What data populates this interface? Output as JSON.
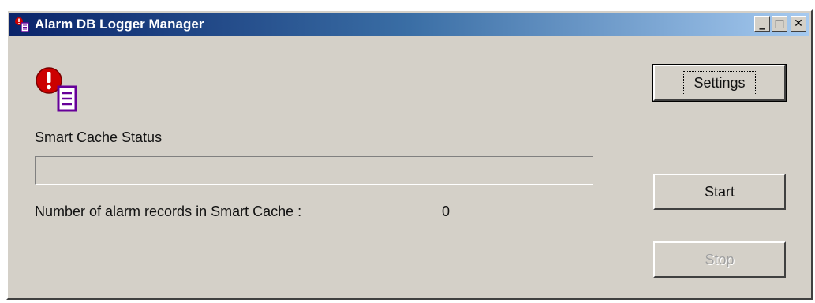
{
  "window": {
    "title": "Alarm DB Logger Manager",
    "title_icon": "alarm-db-icon",
    "controls": {
      "minimize": "_",
      "maximize": "□",
      "close": "✕"
    }
  },
  "main": {
    "app_icon": "alarm-database-icon",
    "smart_cache_label": "Smart Cache Status",
    "progress_fraction": 0,
    "records_label": "Number of alarm records in Smart Cache :",
    "records_count": "0"
  },
  "buttons": {
    "settings_label": "Settings",
    "start_label": "Start",
    "stop_label": "Stop"
  },
  "colors": {
    "face": "#d4d0c8",
    "title_start": "#0a246a",
    "title_end": "#a6caf0",
    "alert_red": "#cc0000",
    "doc_purple": "#660099"
  }
}
